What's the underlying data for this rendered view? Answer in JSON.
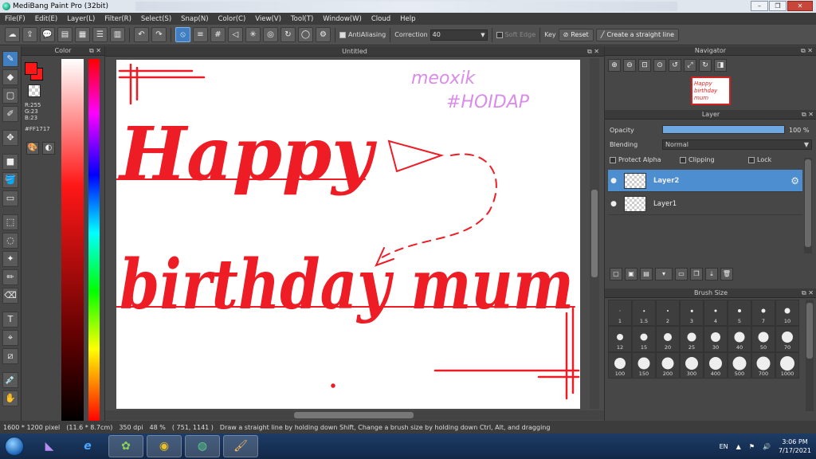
{
  "window": {
    "title": "MediBang Paint Pro (32bit)"
  },
  "menu": [
    "File(F)",
    "Edit(E)",
    "Layer(L)",
    "Filter(R)",
    "Select(S)",
    "Snap(N)",
    "Color(C)",
    "View(V)",
    "Tool(T)",
    "Window(W)",
    "Cloud",
    "Help"
  ],
  "toolbar": {
    "antialiasing_label": "AntiAliasing",
    "correction_label": "Correction",
    "correction_value": "40",
    "soft_edge_label": "Soft Edge",
    "key_label": "Key",
    "reset_label": "Reset",
    "straight_line_label": "Create a straight line"
  },
  "color_panel": {
    "title": "Color",
    "r": "R:255",
    "g": "G:23",
    "b": "B:23",
    "hex": "#FF1717",
    "foreground": "#ff1717"
  },
  "document": {
    "tab": "Untitled",
    "art": {
      "watermark1": "meoxik",
      "watermark2": "#HOIDAP",
      "line1": "Happy",
      "line2": "birthday mum"
    }
  },
  "navigator": {
    "title": "Navigator",
    "thumb_text": "Happy birthday mum"
  },
  "layer_panel": {
    "title": "Layer",
    "opacity_label": "Opacity",
    "opacity_value": "100 %",
    "opacity_fraction": 1.0,
    "blending_label": "Blending",
    "blending_value": "Normal",
    "protect_alpha": "Protect Alpha",
    "clipping": "Clipping",
    "lock": "Lock",
    "layers": [
      {
        "name": "Layer2",
        "active": true
      },
      {
        "name": "Layer1",
        "active": false
      }
    ]
  },
  "brush_size": {
    "title": "Brush Size",
    "sizes": [
      "1",
      "1.5",
      "2",
      "3",
      "4",
      "5",
      "7",
      "10",
      "12",
      "15",
      "20",
      "25",
      "30",
      "40",
      "50",
      "70",
      "100",
      "150",
      "200",
      "300",
      "400",
      "500",
      "700",
      "1000"
    ]
  },
  "status": {
    "size": "1600 * 1200 pixel",
    "cm": "(11.6 * 8.7cm)",
    "dpi": "350 dpi",
    "zoom": "48 %",
    "coords": "( 751, 1141 )",
    "hint": "Draw a straight line by holding down Shift, Change a brush size by holding down Ctrl, Alt, and dragging"
  },
  "taskbar": {
    "lang": "EN",
    "time": "3:06 PM",
    "date": "7/17/2021"
  }
}
